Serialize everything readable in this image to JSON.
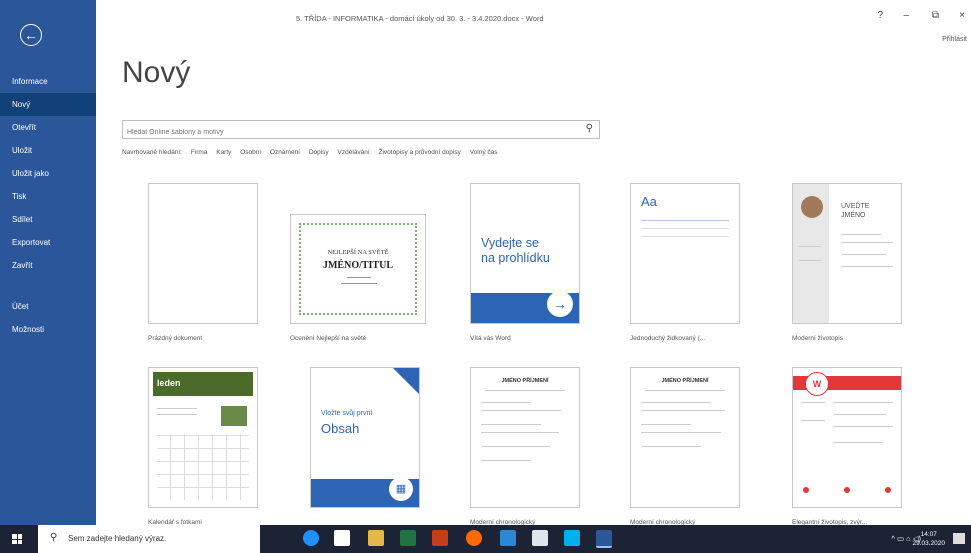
{
  "sidebar": {
    "back_icon": "back-arrow-icon",
    "items": [
      {
        "label": "Informace"
      },
      {
        "label": "Nový"
      },
      {
        "label": "Otevřít"
      },
      {
        "label": "Uložit"
      },
      {
        "label": "Uložit jako"
      },
      {
        "label": "Tisk"
      },
      {
        "label": "Sdílet"
      },
      {
        "label": "Exportovat"
      },
      {
        "label": "Zavřít"
      }
    ],
    "bottom": [
      {
        "label": "Účet"
      },
      {
        "label": "Možnosti"
      }
    ]
  },
  "titlebar": {
    "doc_title": "5. TŘÍDA - INFORMATIKA - domácí úkoly od 30. 3. - 3.4.2020.docx - Word",
    "help": "?",
    "minimize": "–",
    "restore": "⧉",
    "close": "×",
    "signin": "Přihlásit"
  },
  "heading": "Nový",
  "search": {
    "placeholder": "Hledat Online šablony a motivy"
  },
  "suggested": [
    "Navrhované hledání:",
    "Firma",
    "Karty",
    "Osobní",
    "Oznámení",
    "Dopisy",
    "Vzdělávání",
    "Životopisy a průvodní dopisy",
    "Volný čas"
  ],
  "templates": [
    {
      "caption": "Prázdný dokument"
    },
    {
      "caption": "Ocenění Nejlepší na světě",
      "lines": [
        "NEJLEPŠÍ NA SVĚTĚ",
        "JMÉNO/TITUL"
      ]
    },
    {
      "caption": "Vítá vás Word",
      "lines": [
        "Vydejte se",
        "na prohlídku"
      ]
    },
    {
      "caption": "Jednoduchý židkovaný (...",
      "lines": [
        "Aa"
      ]
    },
    {
      "caption": "Moderní životopis",
      "lines": [
        "UVEĎTE",
        "JMÉNO"
      ]
    },
    {
      "caption": "Kalendář s fotkami",
      "lines": [
        "leden"
      ]
    },
    {
      "caption": "Vložte svůj první obsah",
      "lines": [
        "Vložte svůj první",
        "Obsah"
      ]
    },
    {
      "caption": "Moderní chronologický",
      "lines": [
        "JMÉNO PŘÍJMENÍ"
      ]
    },
    {
      "caption": "Moderní chronologický",
      "lines": [
        "JMÉNO PŘÍJMENÍ"
      ]
    },
    {
      "caption": "Elegantní životopis, zvýr...",
      "lines": [
        "W"
      ]
    }
  ],
  "taskbar": {
    "search_placeholder": "Sem zadejte hledaný výraz.",
    "time": "14:07",
    "date": "29.03.2020"
  },
  "colors": {
    "sidebar": "#2b579a",
    "active_nav": "#124078",
    "accent_blue": "#2e64b4",
    "taskbar": "#1b2334"
  }
}
